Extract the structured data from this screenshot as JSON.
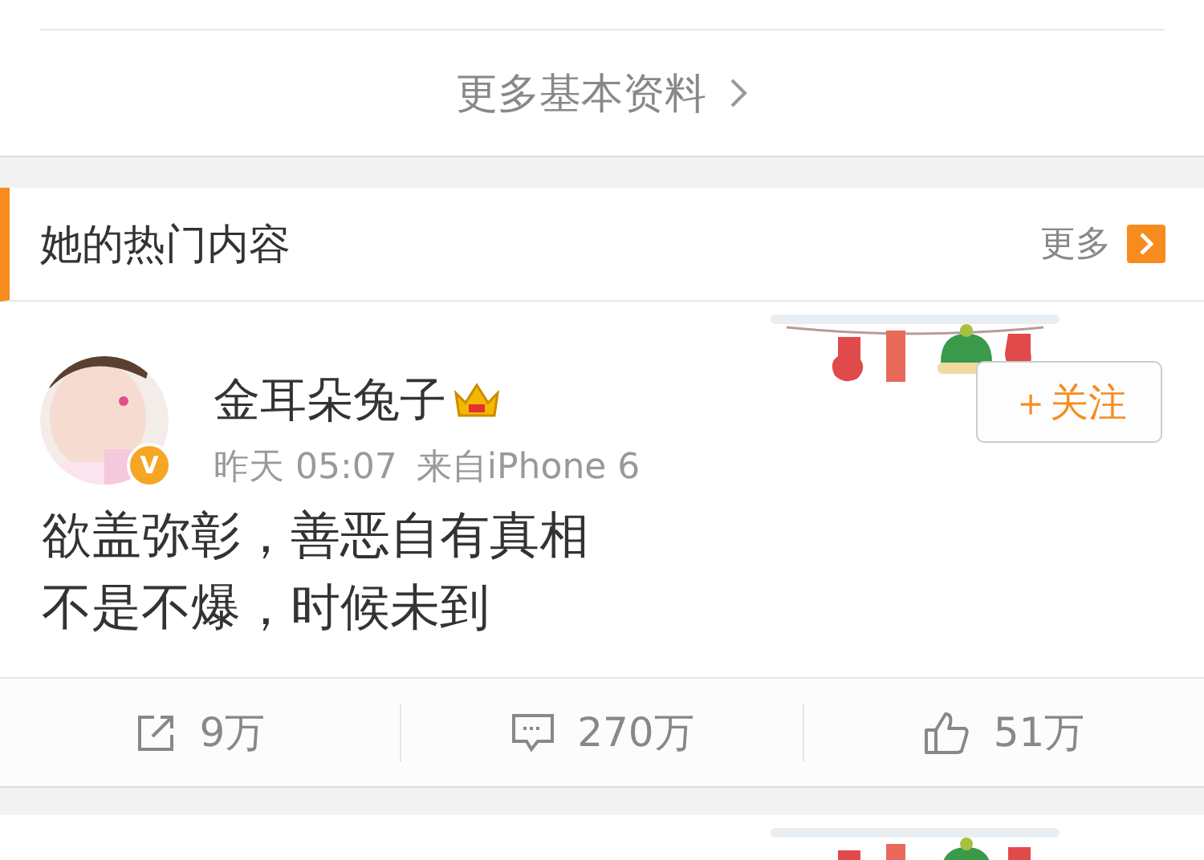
{
  "profile_more": {
    "label": "更多基本资料"
  },
  "section": {
    "title": "她的热门内容",
    "more": "更多"
  },
  "posts": [
    {
      "author": "金耳朵兔子",
      "vip": true,
      "verified_badge": "V",
      "time": "昨天 05:07",
      "source": "来自iPhone 6",
      "follow": "＋关注",
      "lines": [
        "欲盖弥彰，善恶自有真相",
        "不是不爆，时候未到"
      ],
      "actions": [
        {
          "kind": "repost",
          "count": "9万"
        },
        {
          "kind": "comment",
          "count": "270万"
        },
        {
          "kind": "like",
          "count": "51万"
        }
      ]
    }
  ]
}
